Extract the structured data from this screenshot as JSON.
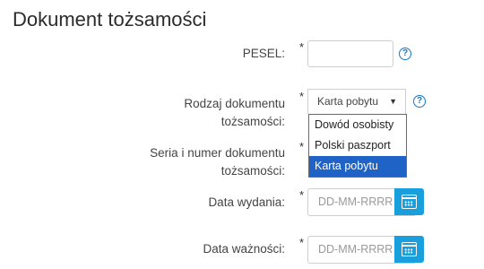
{
  "page": {
    "title": "Dokument tożsamości"
  },
  "form": {
    "required_mark": "*",
    "help_glyph": "?",
    "pesel": {
      "label": "PESEL:",
      "value": ""
    },
    "document_type": {
      "label_line1": "Rodzaj dokumentu",
      "label_line2": "tożsamości:",
      "selected": "Karta pobytu",
      "caret": "▼",
      "options": [
        "Dowód osobisty",
        "Polski paszport",
        "Karta pobytu"
      ],
      "highlighted_index": 2
    },
    "document_number": {
      "label_line1": "Seria i numer dokumentu",
      "label_line2": "tożsamości:"
    },
    "issue_date": {
      "label": "Data wydania:",
      "placeholder": "DD-MM-RRRR"
    },
    "expiry_date": {
      "label": "Data ważności:",
      "placeholder": "DD-MM-RRRR"
    }
  },
  "colors": {
    "accent": "#19a0dc",
    "help_icon": "#1a73c7",
    "highlight": "#1f63c6"
  },
  "icons": {
    "help": "question-circle-icon",
    "calendar": "calendar-icon",
    "dropdown": "caret-down-icon"
  }
}
